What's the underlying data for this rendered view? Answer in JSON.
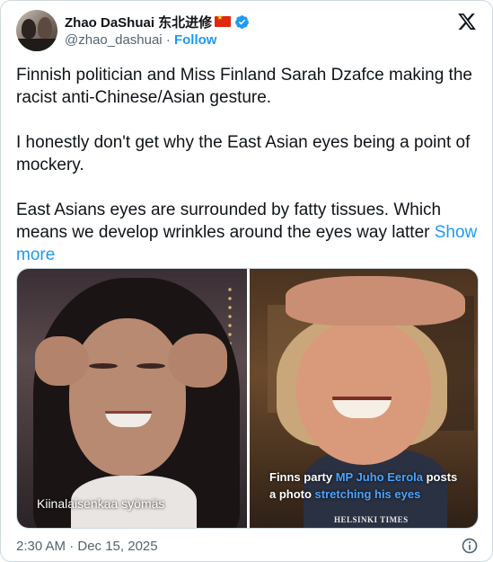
{
  "author": {
    "display_name": "Zhao DaShuai 东北进修",
    "handle": "@zhao_dashuai",
    "separator": "·",
    "follow_label": "Follow"
  },
  "icons": {
    "verified": "verified-badge-icon",
    "flag": "china-flag-icon",
    "brand": "x-logo-icon",
    "info": "info-icon"
  },
  "colors": {
    "accent": "#1d9bf0",
    "text": "#0f1419",
    "muted": "#536471",
    "border": "#cfd9de"
  },
  "tweet": {
    "paragraph_1": "Finnish politician and Miss Finland Sarah Dzafce making the racist anti-Chinese/Asian gesture.",
    "paragraph_2": "I honestly don't get why the East Asian eyes being a point of mockery.",
    "paragraph_3": "East Asians eyes are surrounded by fatty tissues. Which means we develop wrinkles around the eyes way latter",
    "show_more": "Show more"
  },
  "media": {
    "left_caption": "Kiinalaisenkaa syömäs",
    "right_caption_part1": "Finns party ",
    "right_caption_highlight1": "MP Juho Eerola",
    "right_caption_part2": " posts",
    "right_caption_part3": "a photo ",
    "right_caption_highlight2": "stretching his eyes",
    "right_watermark": "HELSINKI TIMES"
  },
  "footer": {
    "timestamp": "2:30 AM · Dec 15, 2025"
  }
}
